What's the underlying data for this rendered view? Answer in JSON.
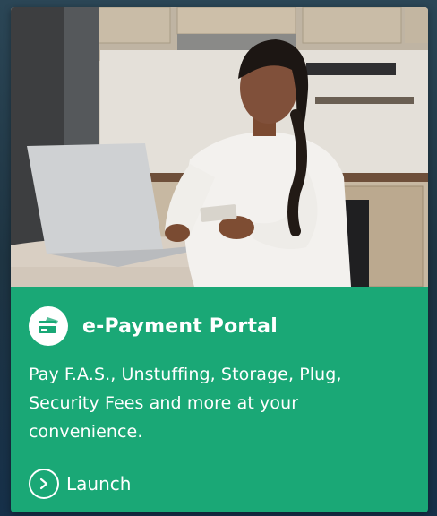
{
  "card": {
    "title": "e-Payment Portal",
    "description": "Pay F.A.S., Unstuffing, Storage, Plug, Security Fees and more at your convenience.",
    "launch_label": "Launch"
  },
  "colors": {
    "panel": "#1aa876",
    "text": "#ffffff"
  },
  "icons": {
    "badge": "payment-card-icon",
    "launch": "chevron-right-icon"
  }
}
